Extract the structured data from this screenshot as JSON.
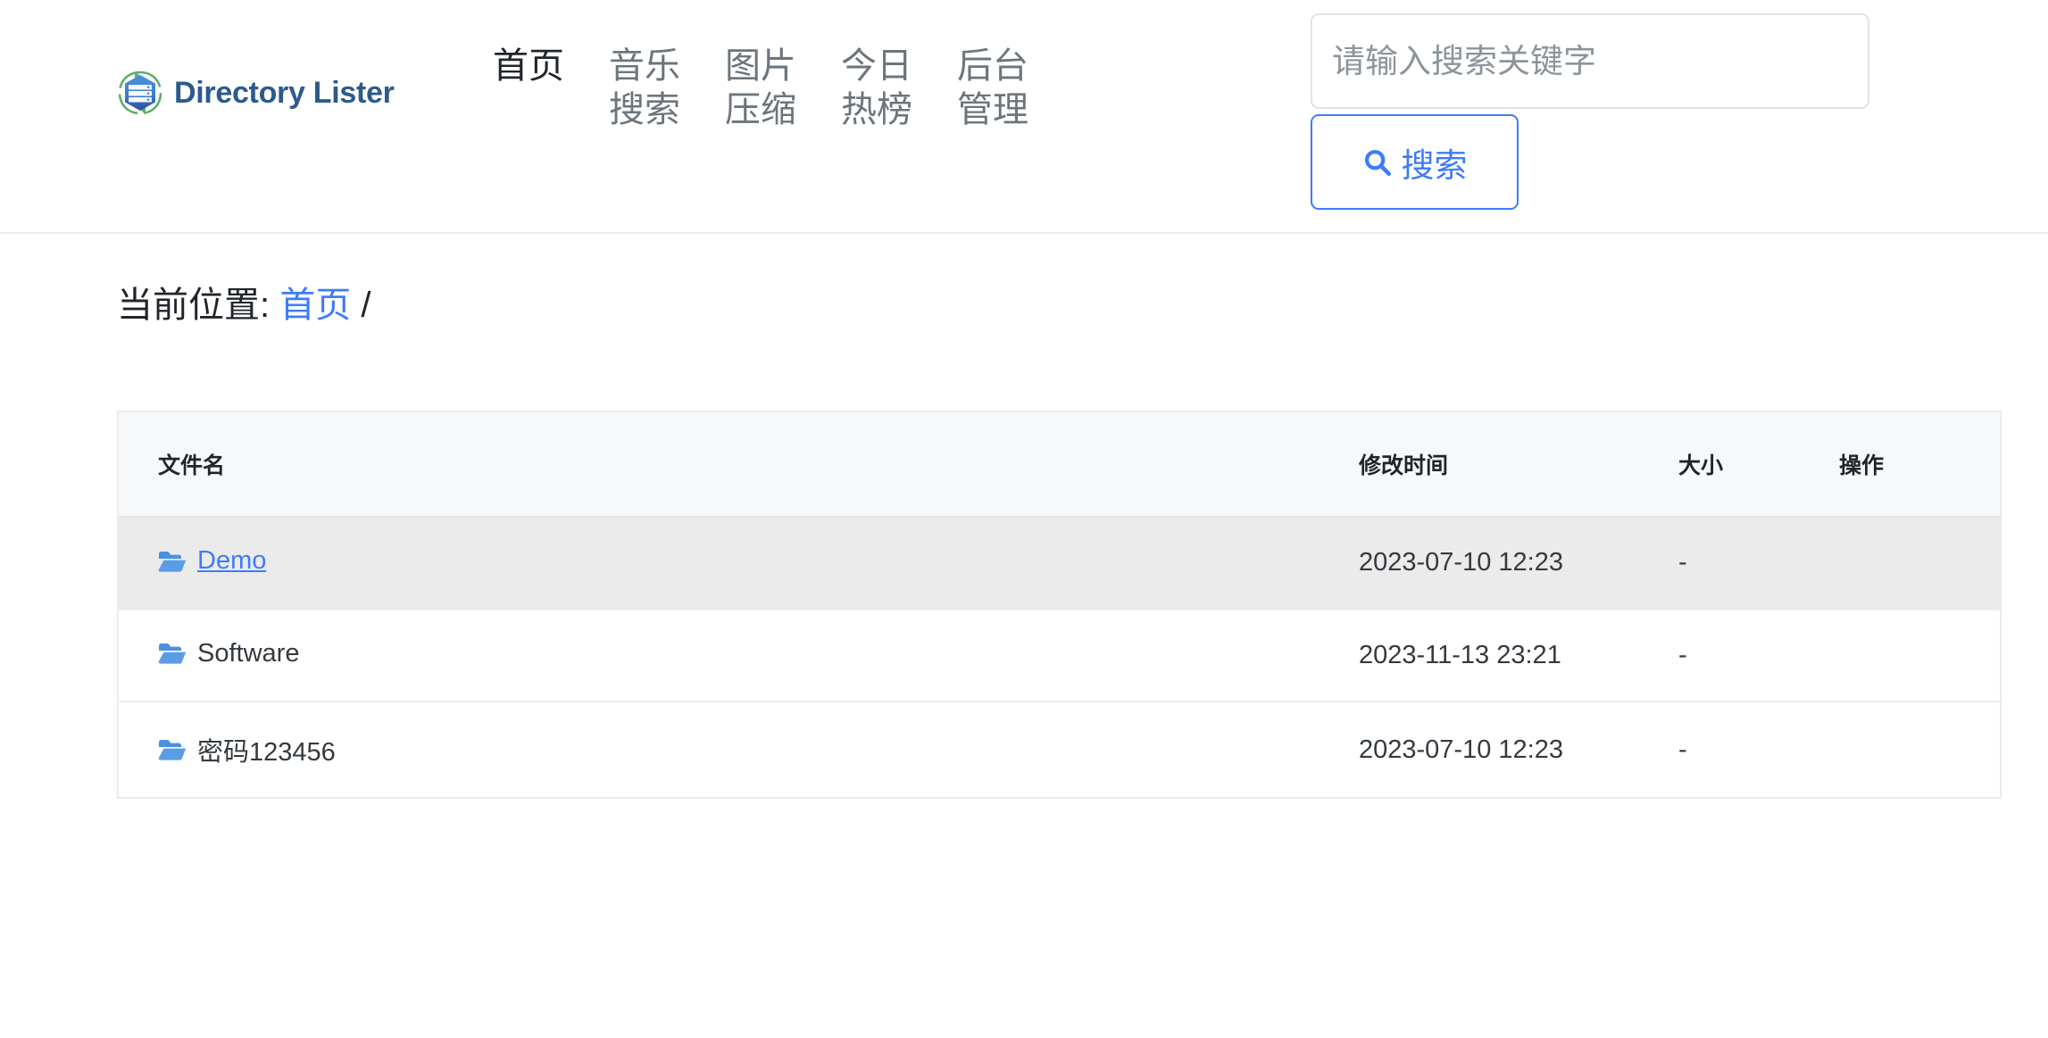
{
  "brand": {
    "name": "Directory Lister",
    "logo_icon": "directory-lister-logo"
  },
  "nav": {
    "items": [
      {
        "label": "首页",
        "active": true
      },
      {
        "label": "音乐搜索",
        "active": false
      },
      {
        "label": "图片压缩",
        "active": false
      },
      {
        "label": "今日热榜",
        "active": false
      },
      {
        "label": "后台管理",
        "active": false
      }
    ]
  },
  "search": {
    "placeholder": "请输入搜索关键字",
    "value": "",
    "button_label": "搜索",
    "button_icon": "search-icon",
    "accent_color": "#3d7bfd"
  },
  "breadcrumb": {
    "label": "当前位置:",
    "home_label": "首页",
    "separator": "/"
  },
  "table": {
    "headers": {
      "name": "文件名",
      "modified": "修改时间",
      "size": "大小",
      "action": "操作"
    },
    "rows": [
      {
        "icon": "folder-icon",
        "name": "Demo",
        "modified": "2023-07-10 12:23",
        "size": "-",
        "action": "",
        "hovered": true
      },
      {
        "icon": "folder-icon",
        "name": "Software",
        "modified": "2023-11-13 23:21",
        "size": "-",
        "action": "",
        "hovered": false
      },
      {
        "icon": "folder-icon",
        "name": "密码123456",
        "modified": "2023-07-10 12:23",
        "size": "-",
        "action": "",
        "hovered": false
      }
    ]
  },
  "colors": {
    "brand_text": "#2d5a8e",
    "accent": "#3d7bfd",
    "nav_inactive": "#6c757d",
    "nav_active": "#212529",
    "row_hover_bg": "#ebebeb",
    "table_header_bg": "#f7f8f9"
  }
}
